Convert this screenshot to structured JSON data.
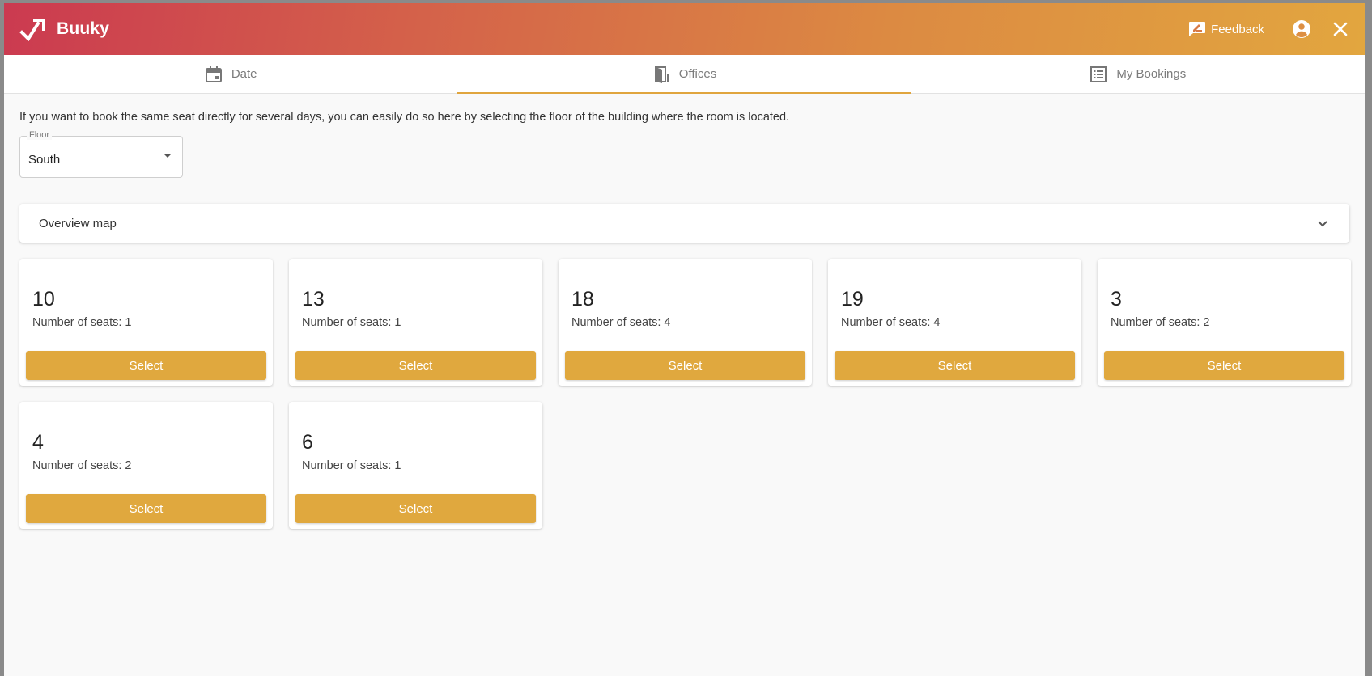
{
  "app": {
    "brand": "Buuky",
    "feedback_label": "Feedback"
  },
  "tabs": [
    {
      "label": "Date",
      "icon": "calendar-icon",
      "active": false
    },
    {
      "label": "Offices",
      "icon": "door-icon",
      "active": true
    },
    {
      "label": "My Bookings",
      "icon": "list-icon",
      "active": false
    }
  ],
  "intro_text": "If you want to book the same seat directly for several days, you can easily do so here by selecting the floor of the building where the room is located.",
  "floor": {
    "label": "Floor",
    "value": "South"
  },
  "overview": {
    "title": "Overview map"
  },
  "rooms": [
    {
      "name": "10",
      "seats": "Number of seats: 1",
      "button": "Select"
    },
    {
      "name": "13",
      "seats": "Number of seats: 1",
      "button": "Select"
    },
    {
      "name": "18",
      "seats": "Number of seats: 4",
      "button": "Select"
    },
    {
      "name": "19",
      "seats": "Number of seats: 4",
      "button": "Select"
    },
    {
      "name": "3",
      "seats": "Number of seats: 2",
      "button": "Select"
    },
    {
      "name": "4",
      "seats": "Number of seats: 2",
      "button": "Select"
    },
    {
      "name": "6",
      "seats": "Number of seats: 1",
      "button": "Select"
    }
  ],
  "colors": {
    "accent": "#e0a83e",
    "header_start": "#cb3a50",
    "header_end": "#e2a63f"
  }
}
